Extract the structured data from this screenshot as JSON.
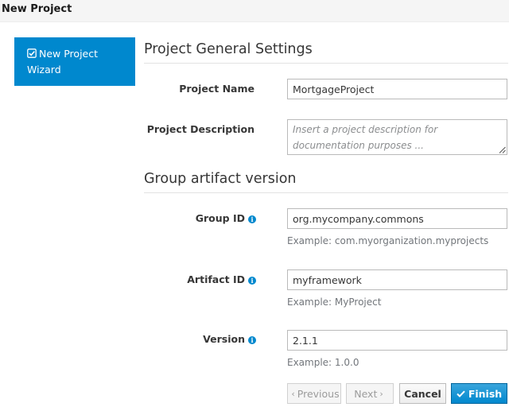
{
  "header": {
    "title": "New Project"
  },
  "wizard": {
    "step_label": "New Project Wizard",
    "step_icon": "check-square-icon"
  },
  "general": {
    "title": "Project General Settings",
    "project_name_label": "Project Name",
    "project_name_value": "MortgageProject",
    "project_description_label": "Project Description",
    "project_description_placeholder": "Insert a project description for documentation purposes ..."
  },
  "gav": {
    "title": "Group artifact version",
    "group_id_label": "Group ID",
    "group_id_value": "org.mycompany.commons",
    "group_id_help": "Example: com.myorganization.myprojects",
    "artifact_id_label": "Artifact ID",
    "artifact_id_value": "myframework",
    "artifact_id_help": "Example: MyProject",
    "version_label": "Version",
    "version_value": "2.1.1",
    "version_help": "Example: 1.0.0"
  },
  "buttons": {
    "previous": "Previous",
    "next": "Next",
    "cancel": "Cancel",
    "finish": "Finish"
  },
  "colors": {
    "primary": "#0088ce",
    "header_bg": "#f5f5f5"
  }
}
